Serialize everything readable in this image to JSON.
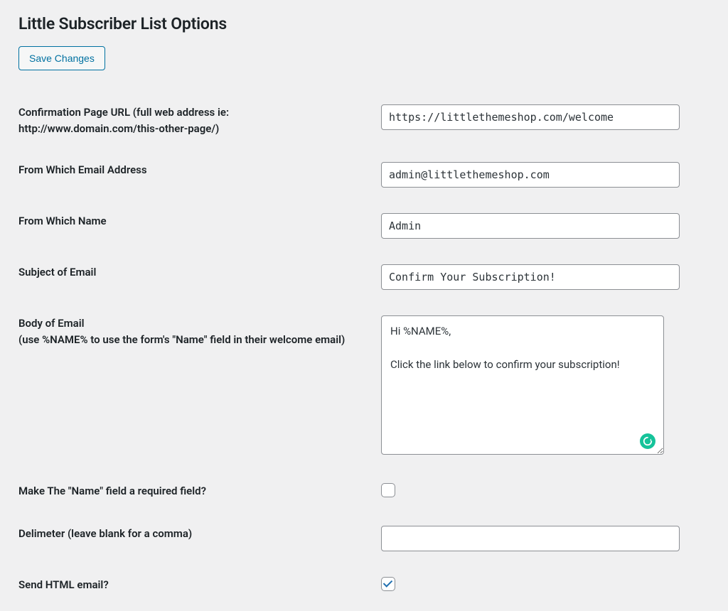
{
  "page": {
    "title": "Little Subscriber List Options"
  },
  "buttons": {
    "save": "Save Changes"
  },
  "fields": {
    "confirmation_url": {
      "label": "Confirmation Page URL (full web address ie: http://www.domain.com/this-other-page/)",
      "value": "https://littlethemeshop.com/welcome"
    },
    "from_email": {
      "label": "From Which Email Address",
      "value": "admin@littlethemeshop.com"
    },
    "from_name": {
      "label": "From Which Name",
      "value": "Admin"
    },
    "subject": {
      "label": "Subject of Email",
      "value": "Confirm Your Subscription!"
    },
    "body": {
      "label": "Body of Email\n(use %NAME% to use the form's \"Name\" field in their welcome email)",
      "value": "Hi %NAME%,\n\nClick the link below to confirm your subscription!"
    },
    "name_required": {
      "label": "Make The \"Name\" field a required field?",
      "checked": false
    },
    "delimeter": {
      "label": "Delimeter (leave blank for a comma)",
      "value": ""
    },
    "send_html": {
      "label": "Send HTML email?",
      "checked": true
    }
  }
}
